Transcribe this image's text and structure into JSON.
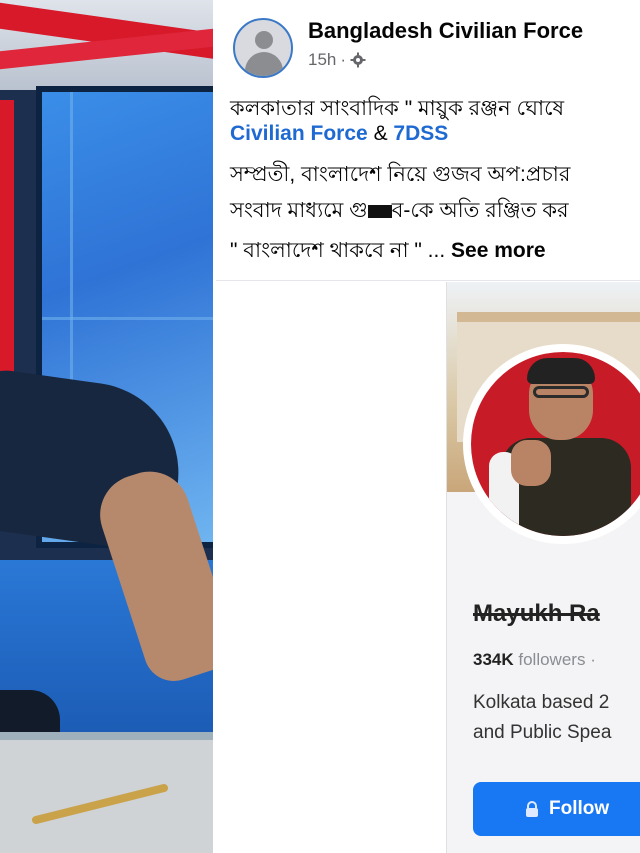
{
  "post": {
    "page_name": "Bangladesh Civilian Force",
    "time": "15h",
    "meta_separator": "·",
    "audience_icon": "gear-icon",
    "line1": "কলকাতার সাংবাদিক \" মায়ুক রঞ্জন ঘোষে",
    "line2_link1": "Civilian Force",
    "line2_amp": "&",
    "line2_link2": "7DSS",
    "line3": "সম্প্রতী, বাংলাদেশ নিয়ে গুজব অপ:প্রচার",
    "line4_pre": "সংবাদ মাধ্যমে গু",
    "line4_post": "ব-কে অতি রঞ্জিত কর",
    "line5": "\" বাংলাদেশ থাকবে না \" ...",
    "see_more": "See more"
  },
  "card": {
    "name": "Mayukh Ra",
    "followers_count": "334K",
    "followers_label": "followers",
    "followers_sep": "·",
    "bio_line1": "Kolkata based 2",
    "bio_line2": "and Public Spea",
    "follow_button": "Follow",
    "follow_icon": "lock-icon"
  },
  "colors": {
    "link": "#1f6ad2",
    "follow_button": "#1877f2",
    "name_text": "#050505",
    "meta_text": "#65676b"
  }
}
